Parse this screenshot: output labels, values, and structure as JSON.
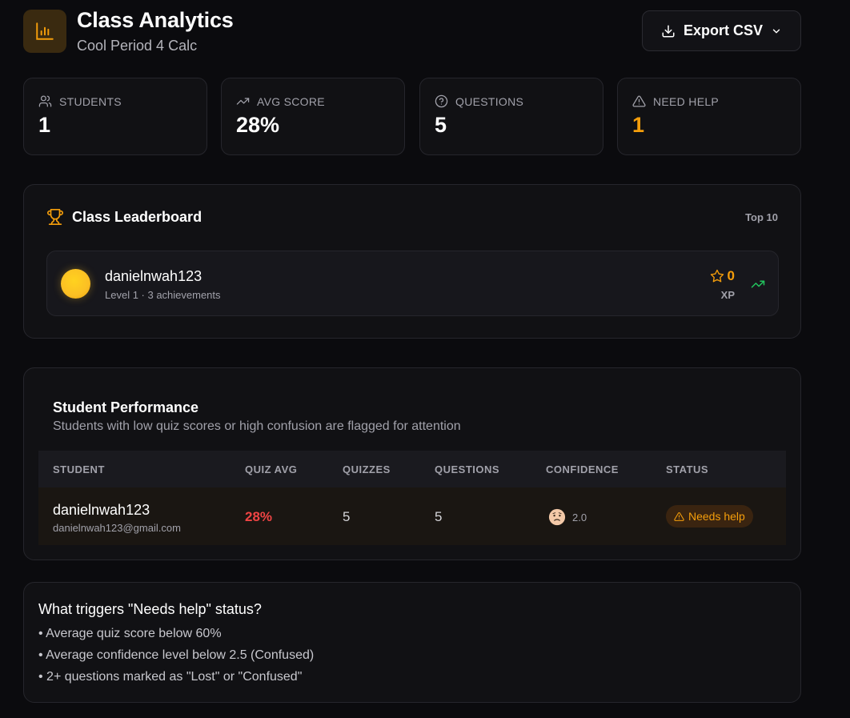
{
  "header": {
    "title": "Class Analytics",
    "subtitle": "Cool Period 4 Calc",
    "export_label": "Export CSV",
    "icon": "bar-chart-icon",
    "accent": "#f59e0b"
  },
  "stats": [
    {
      "label": "STUDENTS",
      "value": "1",
      "icon": "users-icon"
    },
    {
      "label": "AVG SCORE",
      "value": "28%",
      "icon": "trending-up-icon"
    },
    {
      "label": "QUESTIONS",
      "value": "5",
      "icon": "help-circle-icon"
    },
    {
      "label": "NEED HELP",
      "value": "1",
      "icon": "alert-triangle-icon",
      "color": "#f59e0b"
    }
  ],
  "leaderboard": {
    "title": "Class Leaderboard",
    "scope": "Top 10",
    "entries": [
      {
        "name": "danielnwah123",
        "meta": "Level 1 · 3 achievements",
        "xp": "0",
        "xp_label": "XP"
      }
    ]
  },
  "performance": {
    "title": "Student Performance",
    "description": "Students with low quiz scores or high confusion are flagged for attention",
    "columns": [
      "STUDENT",
      "QUIZ AVG",
      "QUIZZES",
      "QUESTIONS",
      "CONFIDENCE",
      "STATUS"
    ],
    "rows": [
      {
        "name": "danielnwah123",
        "email": "danielnwah123@gmail.com",
        "quiz_avg": "28%",
        "quizzes": "5",
        "questions": "5",
        "confidence": "2.0",
        "status": "Needs help"
      }
    ]
  },
  "info": {
    "title": "What triggers \"Needs help\" status?",
    "items": [
      "• Average quiz score below 60%",
      "• Average confidence level below 2.5 (Confused)",
      "• 2+ questions marked as \"Lost\" or \"Confused\""
    ]
  }
}
